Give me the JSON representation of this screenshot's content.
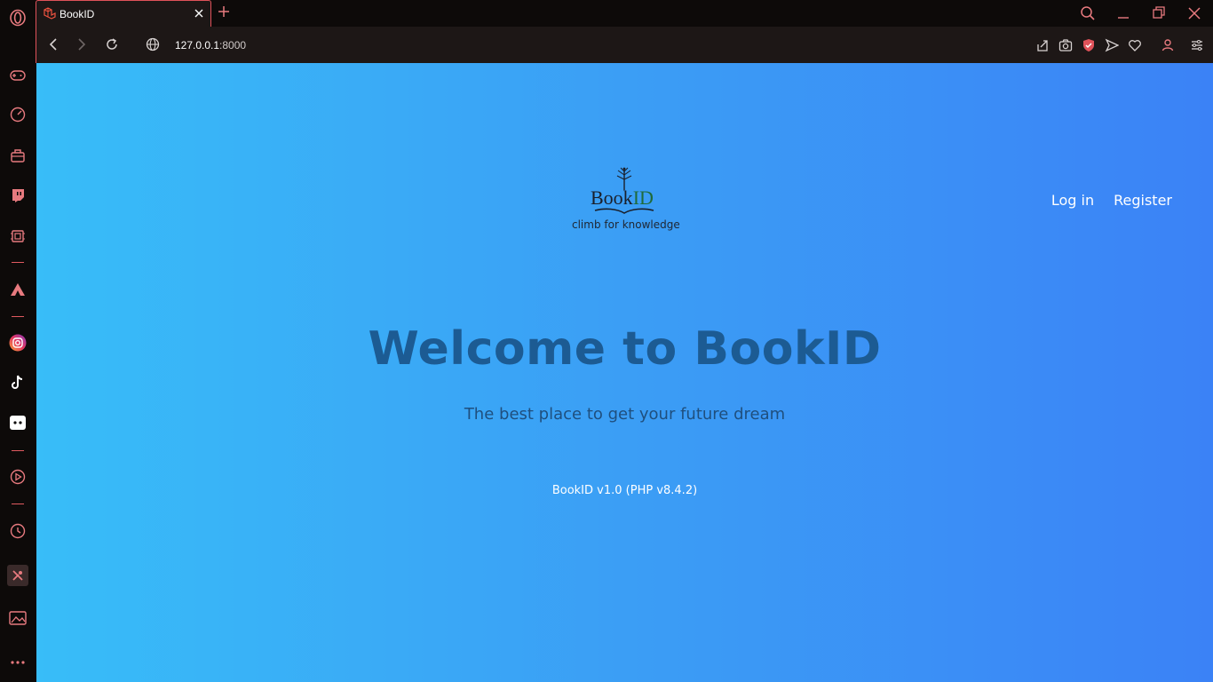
{
  "browser": {
    "tab": {
      "title": "BookID"
    },
    "address": {
      "host": "127.0.0.1",
      "port": ":8000"
    }
  },
  "page": {
    "logo": {
      "title_main": "Book",
      "title_accent": "ID",
      "tagline": "climb for knowledge"
    },
    "nav": {
      "login": "Log in",
      "register": "Register"
    },
    "hero": {
      "title": "Welcome to BookID",
      "subtitle": "The best place to get your future dream"
    },
    "footer": {
      "version": "BookID v1.0 (PHP v8.4.2)"
    }
  },
  "colors": {
    "accent": "#e0525a",
    "gradient_start": "#38bdf8",
    "gradient_end": "#3b82f6",
    "hero_title": "#1c5b93"
  }
}
